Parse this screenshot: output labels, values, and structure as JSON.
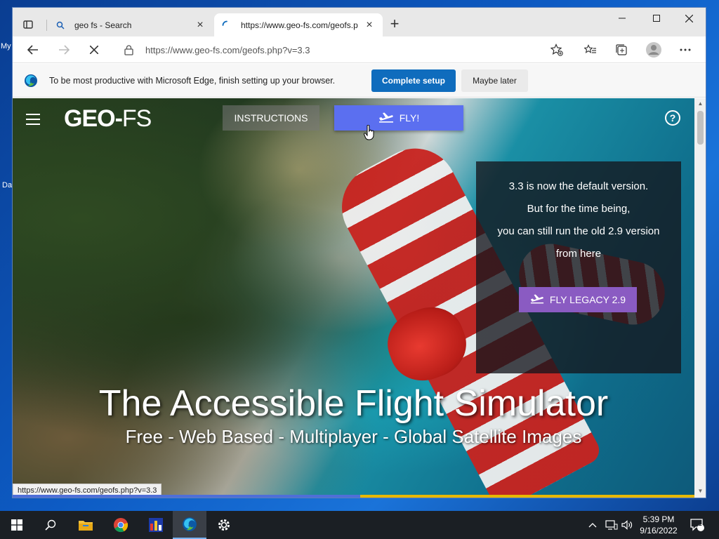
{
  "desktop": {
    "icon_fragments": [
      "My",
      "Da"
    ]
  },
  "browser": {
    "tabs": [
      {
        "title": "geo fs - Search",
        "icon": "search-icon",
        "active": false
      },
      {
        "title": "https://www.geo-fs.com/geofs.p",
        "icon": "loading-spinner-icon",
        "active": true
      }
    ],
    "address": {
      "url": "https://www.geo-fs.com/geofs.php?v=3.3"
    },
    "infobar": {
      "message": "To be most productive with Microsoft Edge, finish setting up your browser.",
      "primary_label": "Complete setup",
      "secondary_label": "Maybe later"
    },
    "status_url": "https://www.geo-fs.com/geofs.php?v=3.3",
    "load_progress_percent": 51
  },
  "page": {
    "logo_geo": "GEO",
    "logo_fs": "FS",
    "instructions_label": "INSTRUCTIONS",
    "fly_label": "FLY!",
    "help_label": "?",
    "notice": {
      "lines": [
        "3.3 is now the default version.",
        "But for the time being,",
        "you can still run the old 2.9 version",
        "from here"
      ],
      "legacy_label": "FLY LEGACY 2.9"
    },
    "hero_title": "The Accessible Flight Simulator",
    "hero_subtitle": "Free - Web Based - Multiplayer - Global Satellite Images"
  },
  "taskbar": {
    "time": "5:39 PM",
    "date": "9/16/2022",
    "notification_count": "1",
    "apps": [
      "start-icon",
      "search-icon",
      "file-explorer-icon",
      "chrome-icon",
      "app-icon",
      "edge-icon",
      "settings-icon"
    ]
  },
  "colors": {
    "edge_accent": "#0f6cbd",
    "fly_button": "#5b6ff0",
    "legacy_button": "#8a5bc2",
    "progress_fill": "#4f6fd8",
    "progress_track": "#e6b800"
  }
}
